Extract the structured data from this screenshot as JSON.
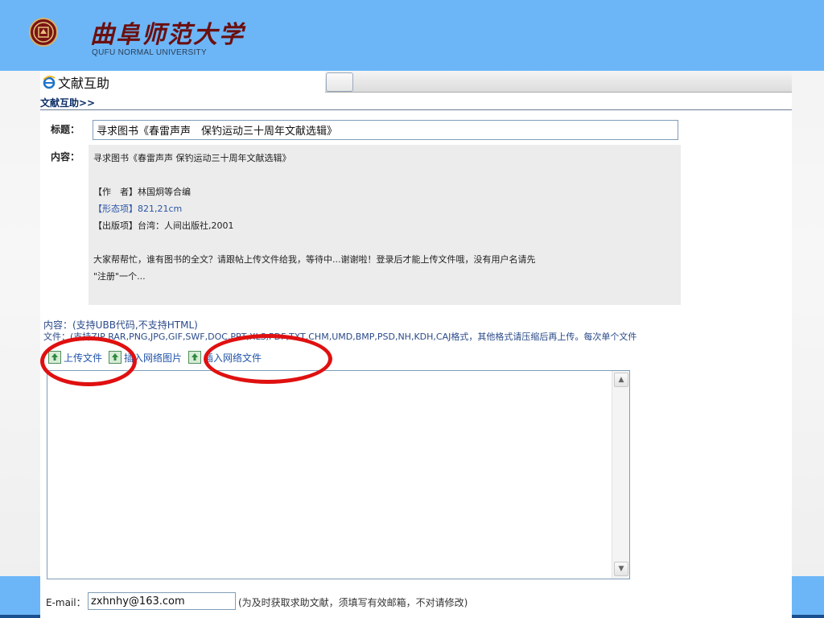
{
  "header": {
    "university_cn": "曲阜师范大学",
    "university_en": "QUFU NORMAL UNIVERSITY",
    "seal_text": "曲阜师范大学"
  },
  "browser": {
    "tab_title": "文献互助"
  },
  "breadcrumb": "文献互助>>",
  "form": {
    "title_label": "标题：",
    "title_value": "寻求图书《春雷声声　保钓运动三十周年文献选辑》",
    "content_label": "内容：",
    "content_lines": [
      "寻求图书《春雷声声 保钓运动三十周年文献选辑》",
      "",
      "【作　者】林国炯等合编",
      "【形态项】821,21cm",
      "【出版项】台湾：人间出版社,2001",
      "",
      "大家帮帮忙，谁有图书的全文？请跟帖上传文件给我，等待中...谢谢啦！登录后才能上传文件哦，没有用户名请先",
      "\"注册\"一个..."
    ],
    "hint_content": "内容：(支持UBB代码,不支持HTML)",
    "hint_files": "文件：(支持ZIP,RAR,PNG,JPG,GIF,SWF,DOC,PPT,XLS,PDF,TXT,CHM,UMD,BMP,PSD,NH,KDH,CAJ格式，其他格式请压缩后再上传。每次单个文件",
    "toolbar": {
      "upload": "上传文件",
      "insert_image": "插入网络图片",
      "insert_file": "插入网络文件"
    },
    "editor_value": "",
    "email_label": "E-mail：",
    "email_value": "zxhnhy@163.com",
    "email_hint": "(为及时获取求助文献，须填写有效邮箱，不对请修改)"
  },
  "colors": {
    "header_blue": "#6cb6f7",
    "annotation_red": "#e01010",
    "link_blue": "#2255aa",
    "footer_navy": "#1a4f8f"
  }
}
